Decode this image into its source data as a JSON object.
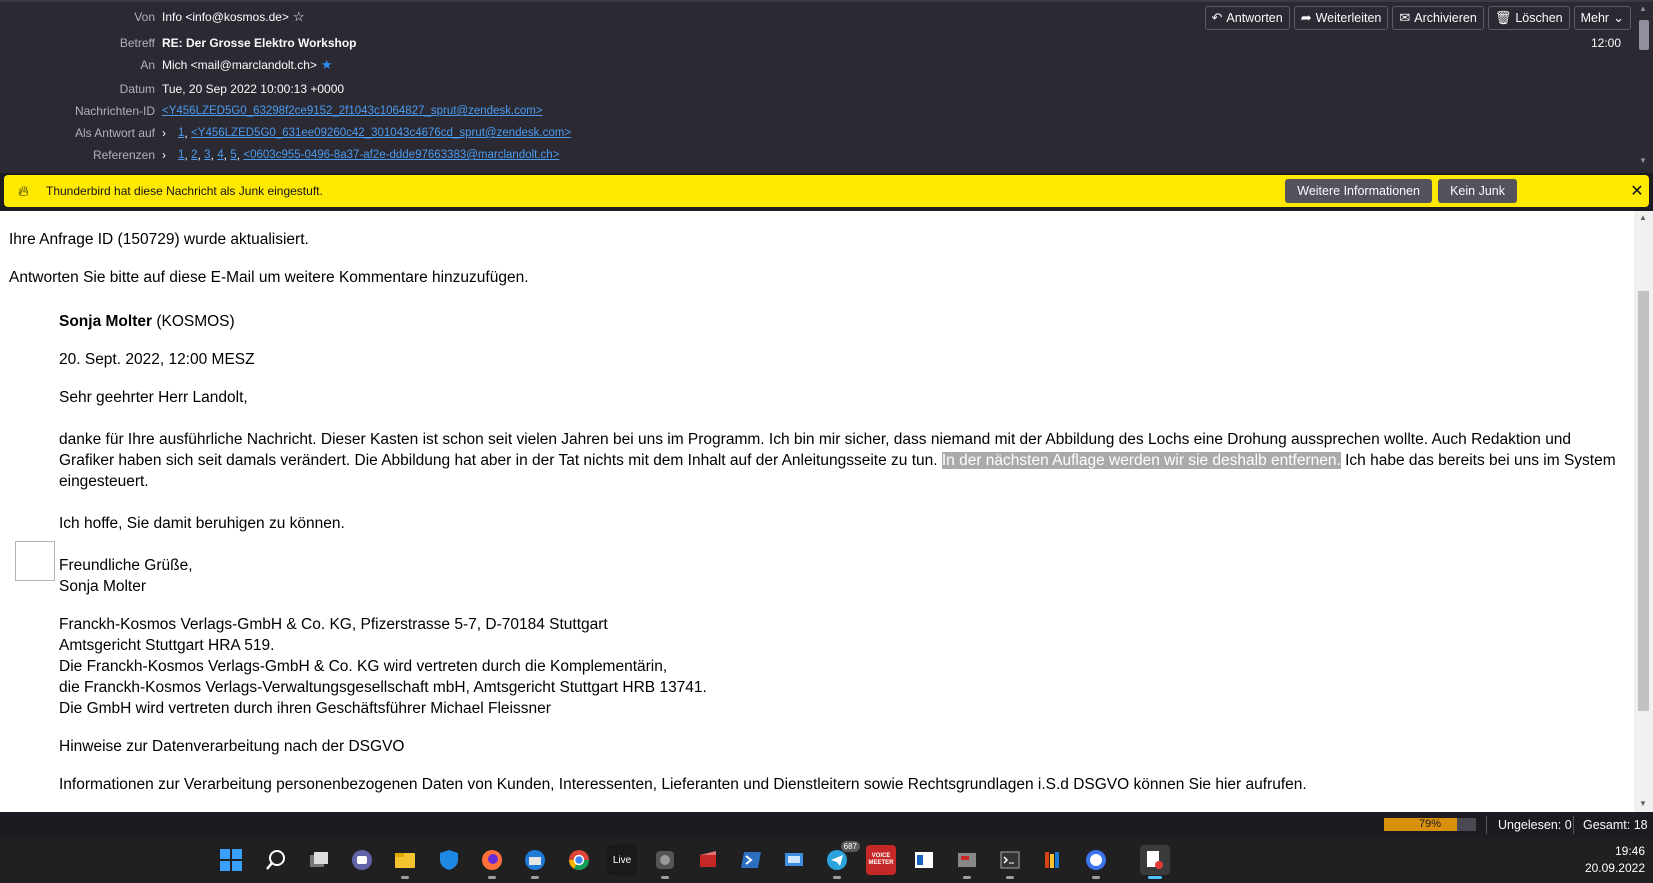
{
  "header": {
    "from_label": "Von",
    "from_value": "Info <info@kosmos.de>",
    "subject_label": "Betreff",
    "subject_value": "RE: Der Grosse Elektro Workshop",
    "to_label": "An",
    "to_value": "Mich <mail@marclandolt.ch>",
    "date_label": "Datum",
    "date_value": "Tue, 20 Sep 2022 10:00:13 +0000",
    "msgid_label": "Nachrichten-ID",
    "msgid_value": "<Y456LZED5G0_63298f2ce9152_2f1043c1064827_sprut@zendesk.com>",
    "inreplyto_label": "Als Antwort auf",
    "inreplyto_num": "1",
    "inreplyto_value": "<Y456LZED5G0_631ee09260c42_301043c4676cd_sprut@zendesk.com>",
    "refs_label": "Referenzen",
    "refs_nums": [
      "1",
      "2",
      "3",
      "4",
      "5"
    ],
    "refs_value": "<0603c955-0496-8a37-af2e-ddde97663383@marclandolt.ch>",
    "time": "12:00",
    "toolbar": {
      "reply": "Antworten",
      "forward": "Weiterleiten",
      "archive": "Archivieren",
      "delete": "Löschen",
      "more": "Mehr"
    }
  },
  "junkbar": {
    "message": "Thunderbird hat diese Nachricht als Junk eingestuft.",
    "more_info": "Weitere Informationen",
    "not_junk": "Kein Junk"
  },
  "body": {
    "line1": "Ihre Anfrage ID (150729) wurde aktualisiert.",
    "line2": "Antworten Sie bitte auf diese E-Mail um weitere Kommentare hinzuzufügen.",
    "author_name": "Sonja Molter",
    "author_org": " (KOSMOS)",
    "date": "20. Sept. 2022, 12:00 MESZ",
    "greeting": "Sehr geehrter Herr Landolt,",
    "para_l1": "danke für Ihre ausführliche Nachricht. Dieser Kasten ist schon seit vielen Jahren bei uns im Programm. Ich bin mir sicher, dass niemand mit der Abbildung des Lochs eine Drohung aussprechen wollte. Auch Redaktion und",
    "para_l2a": "Grafiker haben sich seit damals verändert. Die Abbildung hat aber in der Tat nichts mit dem Inhalt auf der Anleitungsseite zu tun. ",
    "para_l2_highlight": "In der nächsten Auflage werden wir sie deshalb entfernen.",
    "para_l2b": " Ich habe das bereits bei uns im System",
    "para_l3": "eingesteuert.",
    "hope": "Ich hoffe, Sie damit beruhigen zu können.",
    "closing": "Freundliche Grüße,",
    "sign_name": "Sonja Molter",
    "company1": "Franckh-Kosmos Verlags-GmbH & Co. KG, Pfizerstrasse 5-7, D-70184 Stuttgart",
    "company2": "Amtsgericht Stuttgart HRA 519.",
    "company3": "Die Franckh-Kosmos Verlags-GmbH & Co. KG wird vertreten durch die Komplementärin,",
    "company4": "die Franckh-Kosmos Verlags-Verwaltungsgesellschaft mbH, Amtsgericht Stuttgart HRB 13741.",
    "company5": "Die GmbH wird vertreten durch ihren Geschäftsführer Michael Fleissner",
    "dsgvo_title": "Hinweise zur Datenverarbeitung nach der DSGVO",
    "dsgvo_text": "Informationen zur Verarbeitung personenbezogenen Daten von Kunden, Interessenten, Lieferanten und Dienstleitern sowie Rechtsgrundlagen i.S.d DSGVO können Sie hier aufrufen."
  },
  "status": {
    "progress_label": "79%",
    "progress_value": 0.79,
    "unread": "Ungelesen: 0",
    "total": "Gesamt: 18"
  },
  "taskbar": {
    "live_label": "Live",
    "telegram_badge": "687",
    "voicemeeter_label": "VOICE MEETER",
    "time": "19:46",
    "date": "20.09.2022"
  },
  "colors": {
    "header_bg": "#2b2a33",
    "junk_bar": "#ffe900",
    "link": "#4b9bf0",
    "progress": "#d9900a",
    "star": "#2f8cf5"
  }
}
